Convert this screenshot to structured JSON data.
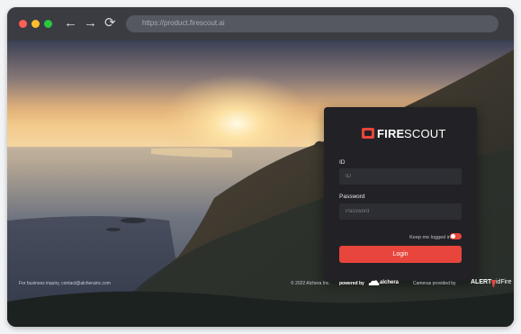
{
  "browser": {
    "url": "https://product.firescout.ai",
    "nav_icons": [
      "arrow-left-icon",
      "arrow-right-icon",
      "reload-icon"
    ]
  },
  "login": {
    "brand_bold": "FIRE",
    "brand_light": "SCOUT",
    "id_label": "ID",
    "id_placeholder": "ID",
    "password_label": "Password",
    "password_placeholder": "Password",
    "keep_logged_in": "Keep me logged in",
    "keep_logged_in_on": true,
    "login_button": "Login"
  },
  "footer": {
    "inquiry": "For business inquiry, contact@alcherainc.com",
    "copyright": "© 2022 Alchera Inc.",
    "powered_by": "powered by",
    "powered_brand": "alchera",
    "cameras": "Cameras provided by",
    "camera_brand_a": "ALERT",
    "camera_brand_b": "idFire"
  },
  "colors": {
    "accent": "#e8453c",
    "panel": "#222226",
    "field": "#2d2e33"
  }
}
